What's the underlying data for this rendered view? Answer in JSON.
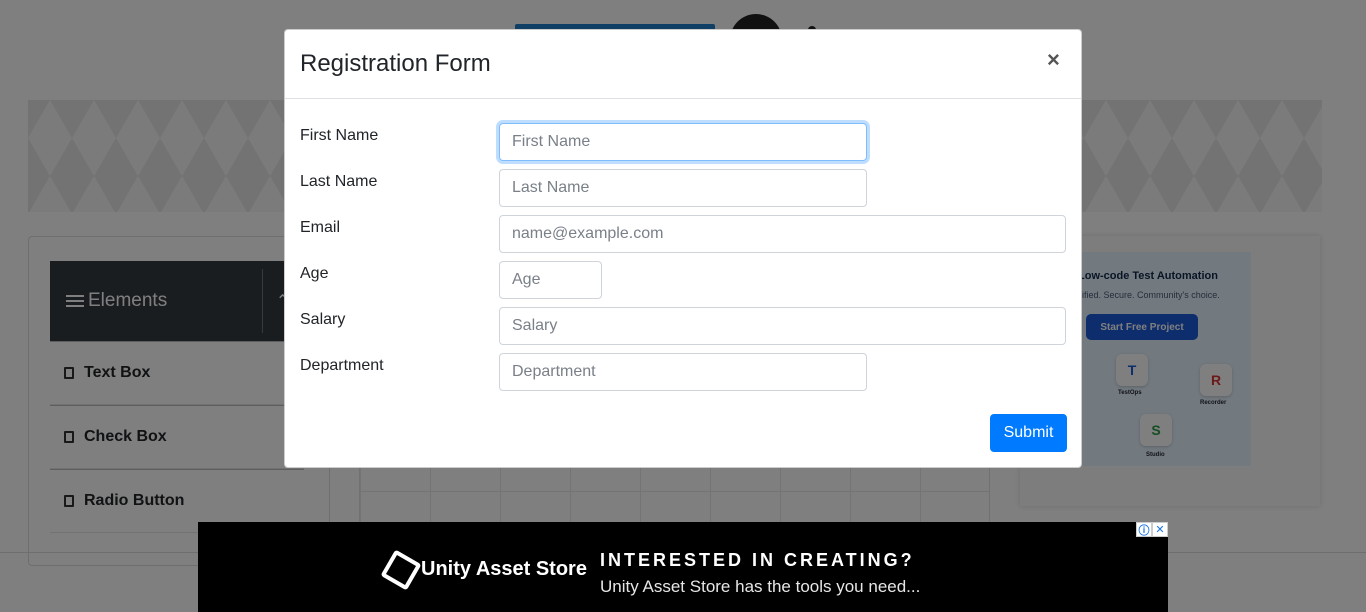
{
  "sidebar": {
    "title": "Elements",
    "items": [
      {
        "label": "Text Box"
      },
      {
        "label": "Check Box"
      },
      {
        "label": "Radio Button"
      }
    ]
  },
  "side_ad": {
    "title": "Low-code Test Automation",
    "subtitle": "ified. Secure. Community's choice.",
    "button": "Start Free Project",
    "tiles": [
      {
        "letter": "T",
        "label": "TestOps"
      },
      {
        "letter": "R",
        "label": "Recorder"
      },
      {
        "letter": "S",
        "label": "Studio"
      }
    ]
  },
  "modal": {
    "title": "Registration Form",
    "close": "×",
    "fields": [
      {
        "label": "First Name",
        "placeholder": "First Name"
      },
      {
        "label": "Last Name",
        "placeholder": "Last Name"
      },
      {
        "label": "Email",
        "placeholder": "name@example.com"
      },
      {
        "label": "Age",
        "placeholder": "Age"
      },
      {
        "label": "Salary",
        "placeholder": "Salary"
      },
      {
        "label": "Department",
        "placeholder": "Department"
      }
    ],
    "submit": "Submit"
  },
  "bottom_ad": {
    "brand": "Unity Asset Store",
    "headline": "INTERESTED IN CREATING?",
    "subline": "Unity Asset Store has the tools you need...",
    "info_icon": "ⓘ",
    "close_icon": "✕"
  },
  "colors": {
    "primary": "#007bff",
    "sidebar_header": "#343a40",
    "focus_border": "#80bdff"
  }
}
